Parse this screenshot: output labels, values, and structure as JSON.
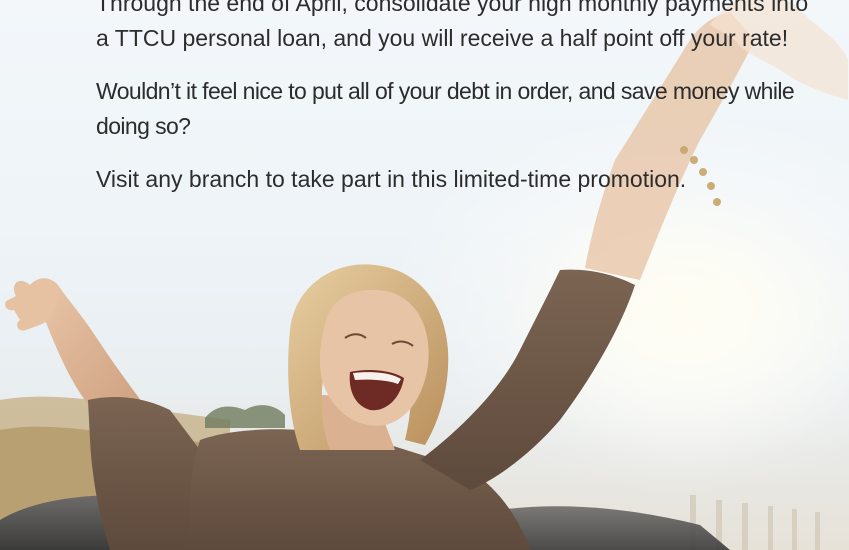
{
  "promo": {
    "paragraph_1": "Through the end of April, consolidate your high monthly payments into a TTCU personal loan, and you will receive a half point off your rate!",
    "paragraph_2": "Wouldn’t it feel nice to put all of your debt in order, and save money while doing so?",
    "paragraph_3": "Visit any branch to take part in this limited-time promotion."
  },
  "image": {
    "subject": "woman-arms-raised-photo"
  }
}
